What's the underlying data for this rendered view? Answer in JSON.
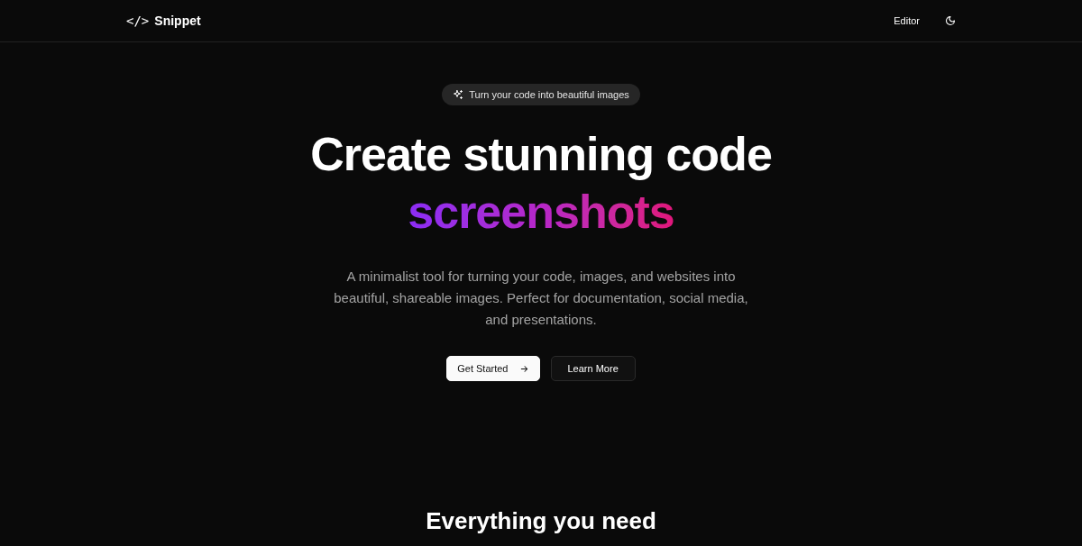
{
  "nav": {
    "logo_mark": "</>",
    "logo_text": "Snippet",
    "links": [
      "Editor"
    ]
  },
  "hero": {
    "badge": "Turn your code into beautiful images",
    "title_line": "Create stunning code",
    "title_highlight": "screenshots",
    "description": "A minimalist tool for turning your code, images, and websites into beautiful, shareable images. Perfect for documentation, social media, and presentations.",
    "buttons": [
      {
        "label": "Get Started",
        "kind": "primary"
      },
      {
        "label": "Learn More",
        "kind": "secondary"
      }
    ]
  },
  "features": {
    "heading": "Everything you need"
  }
}
